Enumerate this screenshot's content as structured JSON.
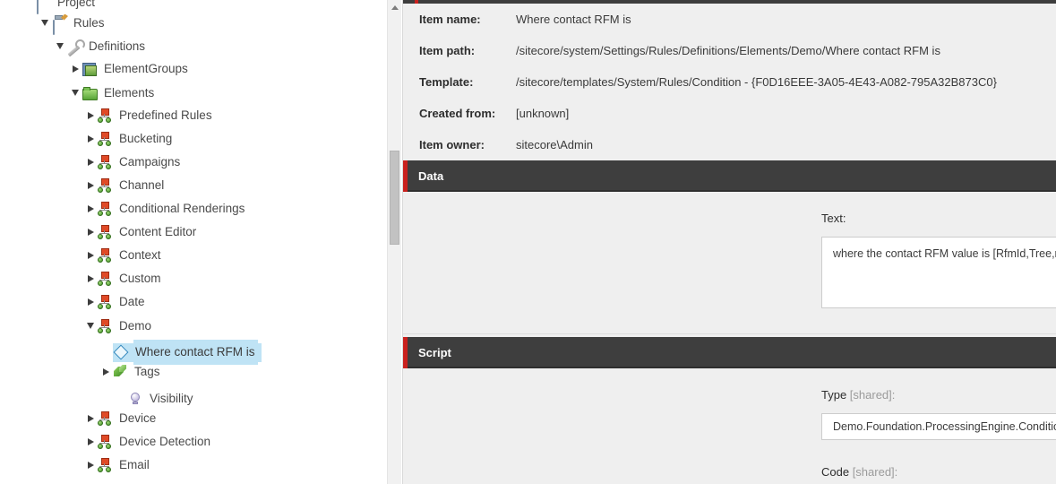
{
  "tree": {
    "scrollbar": {
      "up_arrow": "scroll-up"
    },
    "items": [
      {
        "label": "Project",
        "indent": 40,
        "twisty": "none",
        "icon": "project-icon",
        "selected": false,
        "clipped": true
      },
      {
        "label": "Rules",
        "indent": 58,
        "twisty": "expanded",
        "icon": "clipboard-icon",
        "selected": false
      },
      {
        "label": "Definitions",
        "indent": 75,
        "twisty": "expanded",
        "icon": "wrench-icon",
        "selected": false
      },
      {
        "label": "ElementGroups",
        "indent": 92,
        "twisty": "collapsed",
        "icon": "group-icon",
        "selected": false
      },
      {
        "label": "Elements",
        "indent": 92,
        "twisty": "expanded",
        "icon": "folder-icon",
        "selected": false
      },
      {
        "label": "Predefined Rules",
        "indent": 109,
        "twisty": "collapsed",
        "icon": "ruleset-icon",
        "selected": false
      },
      {
        "label": "Bucketing",
        "indent": 109,
        "twisty": "collapsed",
        "icon": "ruleset-icon",
        "selected": false
      },
      {
        "label": "Campaigns",
        "indent": 109,
        "twisty": "collapsed",
        "icon": "ruleset-icon",
        "selected": false
      },
      {
        "label": "Channel",
        "indent": 109,
        "twisty": "collapsed",
        "icon": "ruleset-icon",
        "selected": false
      },
      {
        "label": "Conditional Renderings",
        "indent": 109,
        "twisty": "collapsed",
        "icon": "ruleset-icon",
        "selected": false
      },
      {
        "label": "Content Editor",
        "indent": 109,
        "twisty": "collapsed",
        "icon": "ruleset-icon",
        "selected": false
      },
      {
        "label": "Context",
        "indent": 109,
        "twisty": "collapsed",
        "icon": "ruleset-icon",
        "selected": false
      },
      {
        "label": "Custom",
        "indent": 109,
        "twisty": "collapsed",
        "icon": "ruleset-icon",
        "selected": false
      },
      {
        "label": "Date",
        "indent": 109,
        "twisty": "collapsed",
        "icon": "ruleset-icon",
        "selected": false
      },
      {
        "label": "Demo",
        "indent": 109,
        "twisty": "expanded",
        "icon": "ruleset-icon",
        "selected": false
      },
      {
        "label": "Where contact RFM is",
        "indent": 126,
        "twisty": "none",
        "icon": "diamond-icon",
        "selected": true
      },
      {
        "label": "Tags",
        "indent": 126,
        "twisty": "collapsed",
        "icon": "tags-icon",
        "selected": false
      },
      {
        "label": "Visibility",
        "indent": 143,
        "twisty": "none",
        "icon": "bulb-icon",
        "selected": false
      },
      {
        "label": "Device",
        "indent": 109,
        "twisty": "collapsed",
        "icon": "ruleset-icon",
        "selected": false
      },
      {
        "label": "Device Detection",
        "indent": 109,
        "twisty": "collapsed",
        "icon": "ruleset-icon",
        "selected": false
      },
      {
        "label": "Email",
        "indent": 109,
        "twisty": "collapsed",
        "icon": "ruleset-icon",
        "selected": false
      }
    ]
  },
  "quick_info": {
    "rows": [
      {
        "label": "Item name:",
        "value": "Where contact RFM is"
      },
      {
        "label": "Item path:",
        "value": "/sitecore/system/Settings/Rules/Definitions/Elements/Demo/Where contact RFM is"
      },
      {
        "label": "Template:",
        "value": "/sitecore/templates/System/Rules/Condition - {F0D16EEE-3A05-4E43-A082-795A32B873C0}"
      },
      {
        "label": "Created from:",
        "value": "[unknown]"
      },
      {
        "label": "Item owner:",
        "value": "sitecore\\Admin"
      }
    ]
  },
  "data_section": {
    "title": "Data",
    "text_label": "Text:",
    "text_value": "where the contact RFM value is [RfmId,Tree,root=/sitecore/system/Settings/Foundation/ProcessingEngine/RFM Patterns,rfm]"
  },
  "script_section": {
    "title": "Script",
    "type_label": "Type",
    "type_shared": " [shared]:",
    "type_value": "Demo.Foundation.ProcessingEngine.Conditionals.RfmMatch, Demo.Foundation.ProcessingEngine",
    "code_label": "Code",
    "code_shared": " [shared]:"
  },
  "colors": {
    "accent_red": "#c9211e",
    "header_dark": "#3e3e3e",
    "panel_bg": "#efefef",
    "selection_blue": "#bfe3f5"
  }
}
